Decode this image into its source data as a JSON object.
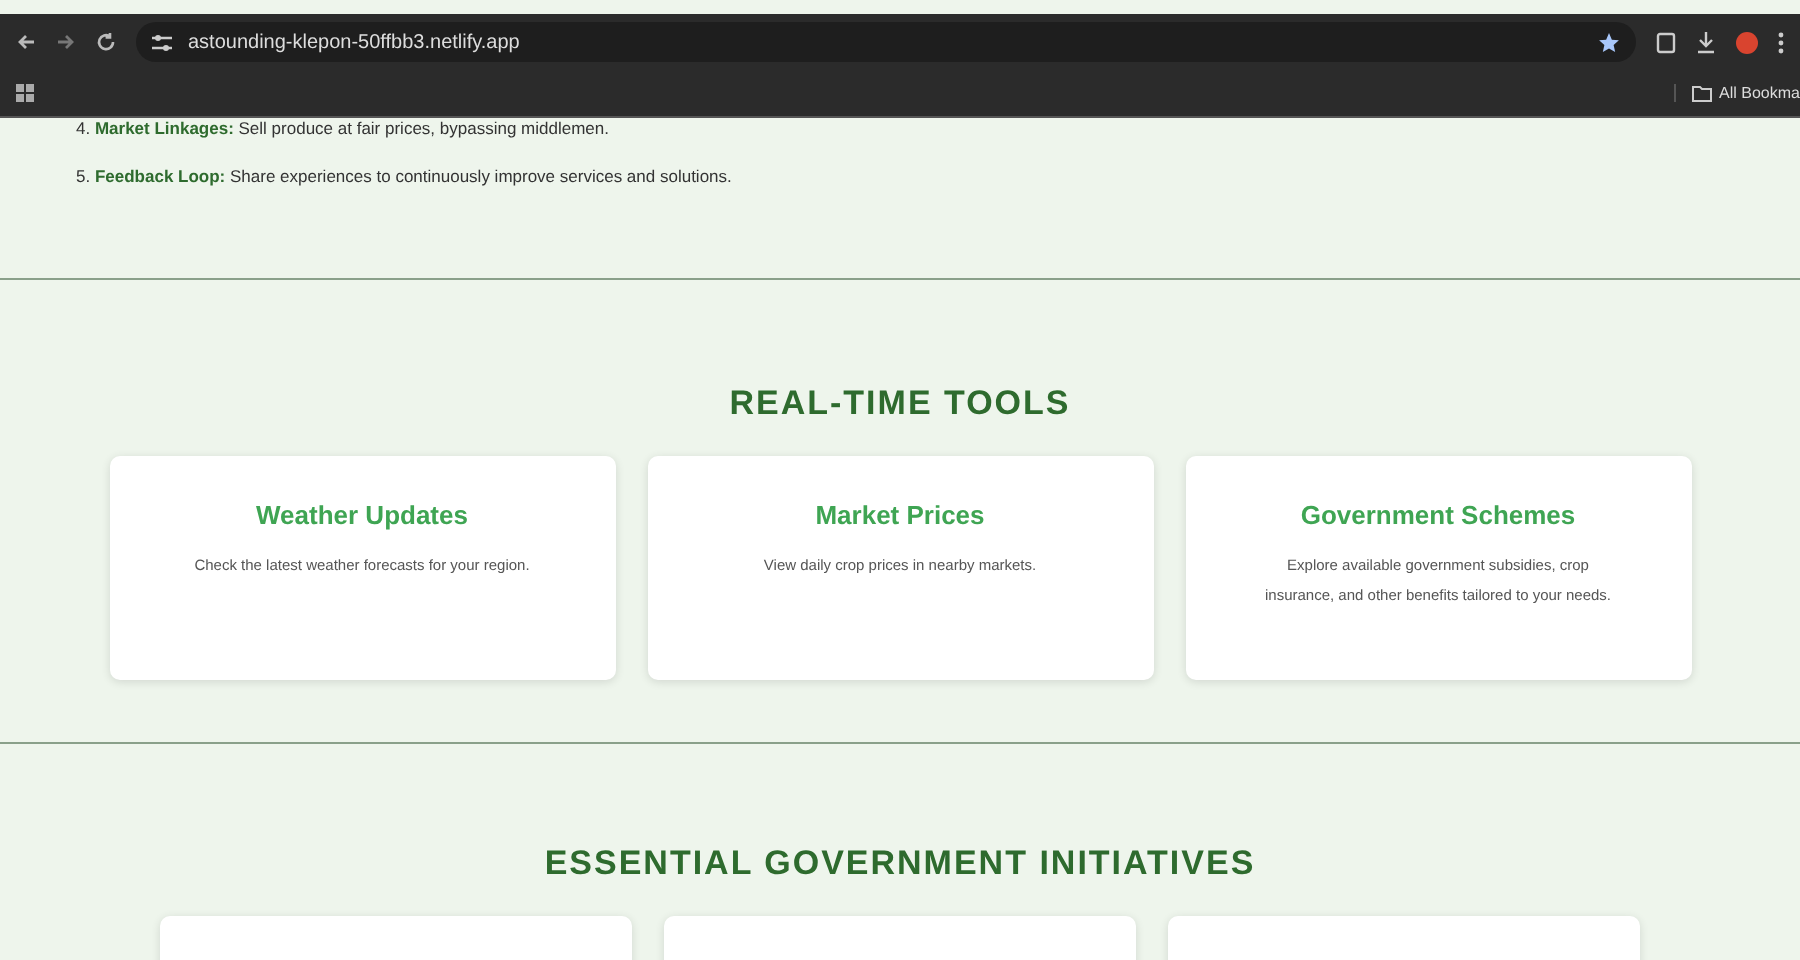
{
  "browser": {
    "url": "astounding-klepon-50ffbb3.netlify.app",
    "bookmarks_label": "All Bookma"
  },
  "steps": [
    {
      "number": "4.",
      "title": "Market Linkages:",
      "text": "Sell produce at fair prices, bypassing middlemen."
    },
    {
      "number": "5.",
      "title": "Feedback Loop:",
      "text": "Share experiences to continuously improve services and solutions."
    }
  ],
  "tools": {
    "heading": "REAL-TIME TOOLS",
    "cards": [
      {
        "title": "Weather Updates",
        "text": "Check the latest weather forecasts for your region."
      },
      {
        "title": "Market Prices",
        "text": "View daily crop prices in nearby markets."
      },
      {
        "title": "Government Schemes",
        "text": "Explore available government subsidies, crop insurance, and other benefits tailored to your needs."
      }
    ]
  },
  "initiatives": {
    "heading": "ESSENTIAL GOVERNMENT INITIATIVES",
    "cards": [
      {
        "kind": "empty"
      },
      {
        "kind": "empty"
      },
      {
        "kind": "empty"
      }
    ]
  }
}
